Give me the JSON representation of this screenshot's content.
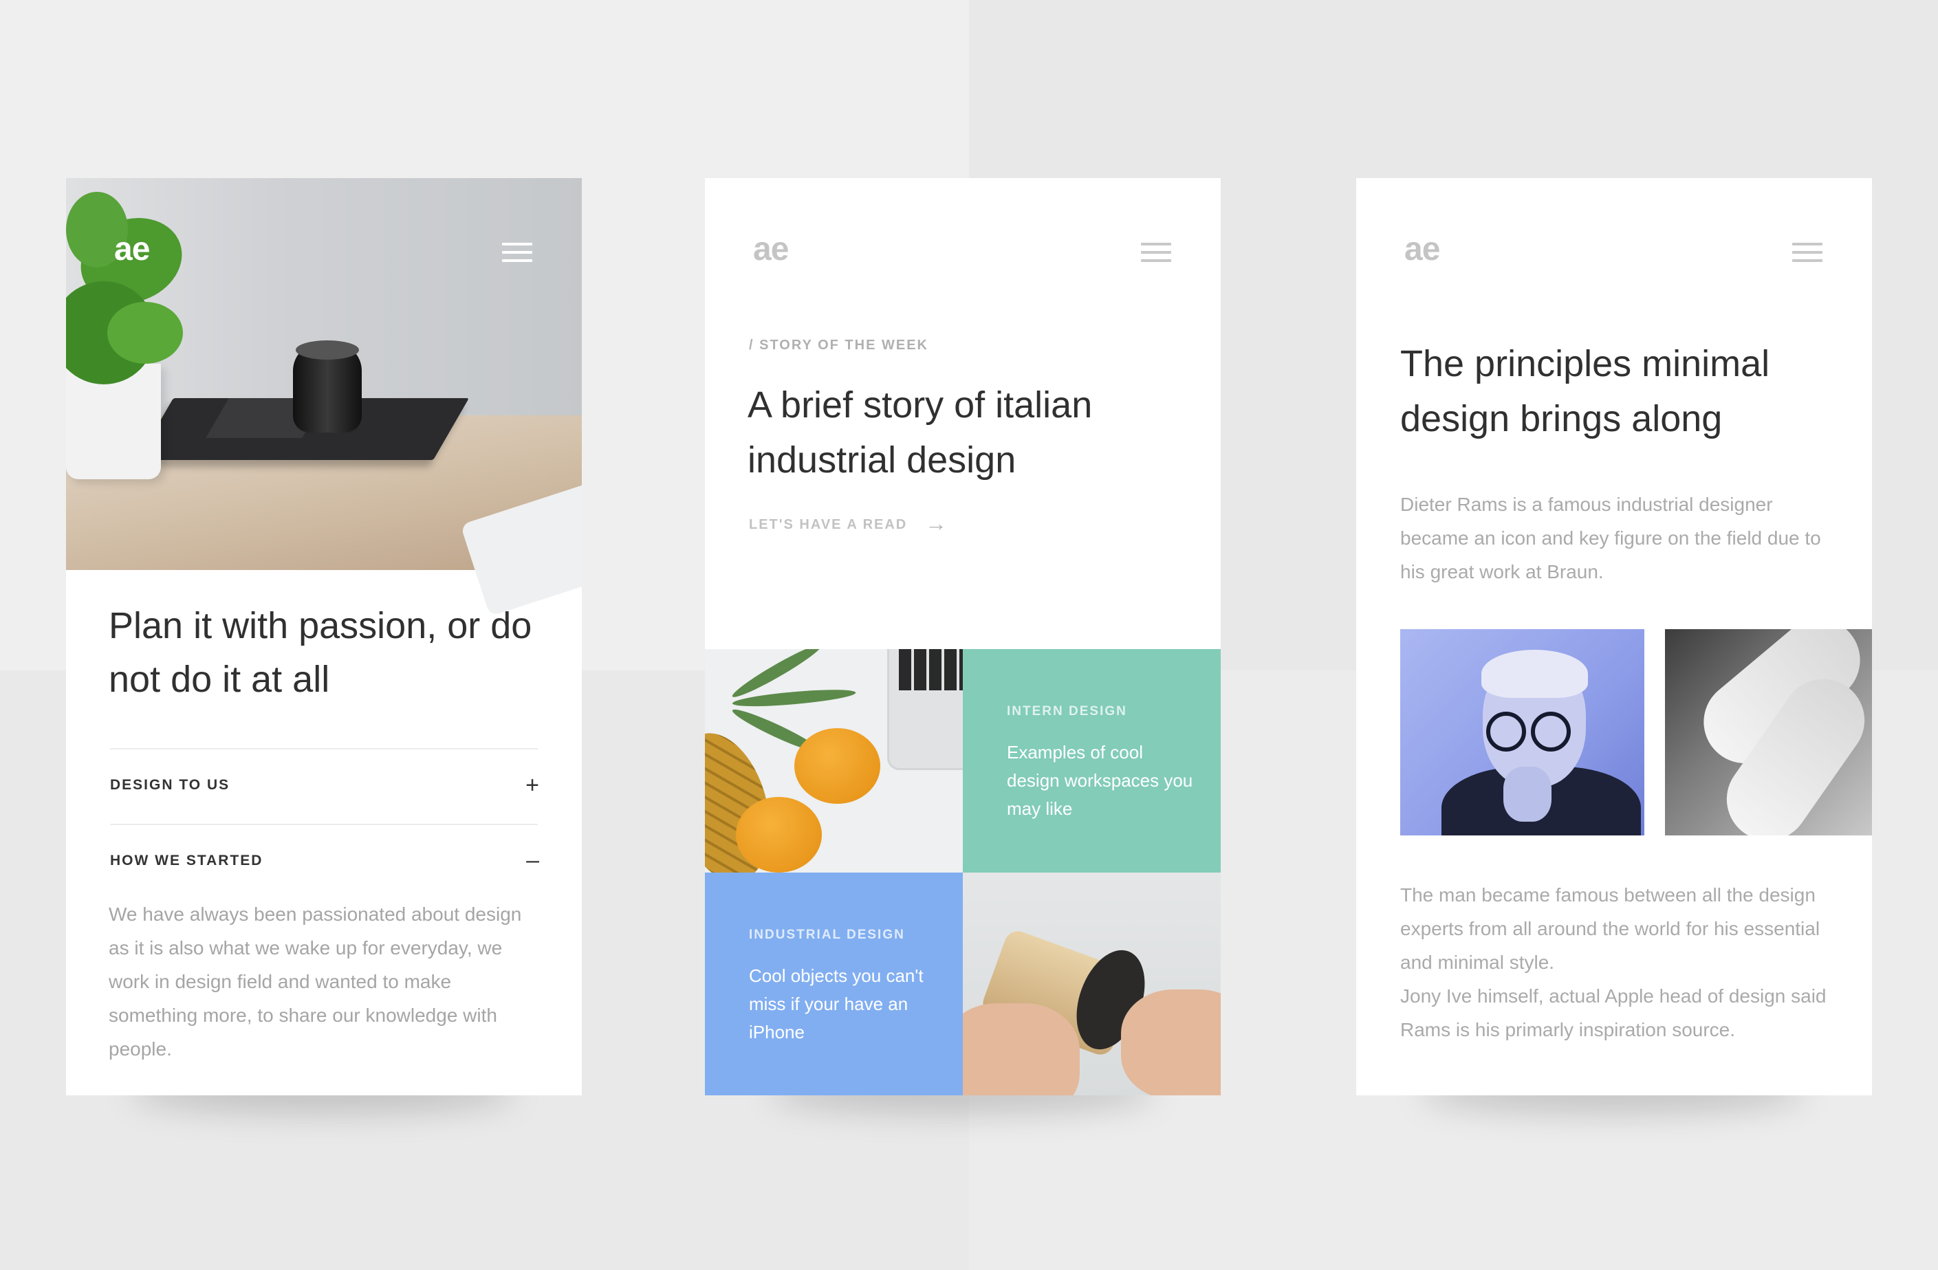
{
  "cards": [
    {
      "logo": "ae",
      "headline": "Plan it with passion, or do not do it at all",
      "accordion": [
        {
          "label": "DESIGN TO US",
          "sign": "+"
        },
        {
          "label": "HOW WE STARTED",
          "sign": "–"
        }
      ],
      "body": "We have always been passionated about design as it is also what we wake up for everyday, we work in design field and wanted to make something more, to share our knowledge with people."
    },
    {
      "logo": "ae",
      "kicker": "/ STORY OF THE WEEK",
      "headline": "A brief story of italian industrial design",
      "cta": "LET'S HAVE A READ",
      "cta_arrow": "→",
      "tiles": [
        {
          "kicker": "INTERN DESIGN",
          "text": "Examples of cool design workspaces you may like",
          "color": "#82ccb8"
        },
        {
          "kicker": "INDUSTRIAL DESIGN",
          "text": "Cool objects you can't miss if your have an iPhone",
          "color": "#81aef0"
        }
      ]
    },
    {
      "logo": "ae",
      "headline": "The principles minimal design brings along",
      "intro": "Dieter Rams is a famous industrial designer became an icon and key figure on the field due to his great work at Braun.",
      "body1": "The man became famous between all the design experts from all around the world for his essential and minimal style.",
      "body2": "Jony Ive himself, actual Apple head of design said Rams is his primarly inspiration source."
    }
  ]
}
